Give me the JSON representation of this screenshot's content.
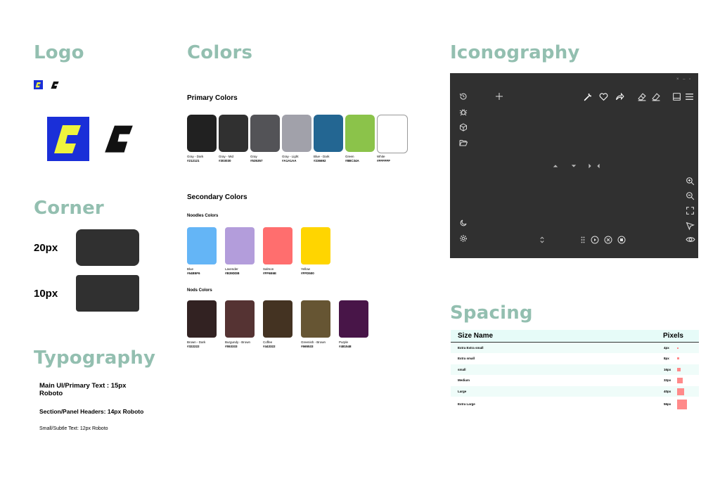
{
  "sections": {
    "logo": "Logo",
    "colors": "Colors",
    "iconography": "Iconography",
    "corner": "Corner",
    "typography": "Typography",
    "spacing": "Spacing"
  },
  "brand": {
    "logo_bg": "#1a2fd8",
    "logo_fg": "#eef33d"
  },
  "colors": {
    "primary_title": "Primary Colors",
    "primary": [
      {
        "name": "Gray - Dark",
        "hex": "#212121"
      },
      {
        "name": "Gray - Mid",
        "hex": "#303030"
      },
      {
        "name": "Gray",
        "hex": "#535357"
      },
      {
        "name": "Gray - Light",
        "hex": "#A1A1AA"
      },
      {
        "name": "Blue - Dark",
        "hex": "#236692"
      },
      {
        "name": "Green",
        "hex": "#8BC34A"
      },
      {
        "name": "White",
        "hex": "#FFFFFF"
      }
    ],
    "secondary_title": "Secondary Colors",
    "noodles_title": "Noodles Colors",
    "noodles": [
      {
        "name": "Blue",
        "hex": "#64B5F6"
      },
      {
        "name": "Lavender",
        "hex": "#B39DDB"
      },
      {
        "name": "Salmon",
        "hex": "#FF6E6E"
      },
      {
        "name": "Yellow",
        "hex": "#FFD500"
      }
    ],
    "nods_title": "Nods Colors",
    "nods": [
      {
        "name": "Brown - Dark",
        "hex": "#322222"
      },
      {
        "name": "Burgundy - Brown",
        "hex": "#553333"
      },
      {
        "name": "Coffee",
        "hex": "#443322"
      },
      {
        "name": "Greenish - Brown",
        "hex": "#665533"
      },
      {
        "name": "Purple",
        "hex": "#481548"
      }
    ]
  },
  "corner": {
    "items": [
      {
        "label": "20px",
        "radius": "20px"
      },
      {
        "label": "10px",
        "radius": "10px"
      }
    ]
  },
  "typography": {
    "main": "Main UI/Primary Text : 15px Roboto",
    "section": "Section/Panel Headers: 14px Roboto",
    "small": "Small/Subtle Text: 12px Roboto"
  },
  "spacing": {
    "col_name": "Size Name",
    "col_pixels": "Pixels",
    "rows": [
      {
        "name": "Extra Extra small",
        "pixels": "4px"
      },
      {
        "name": "Extra small",
        "pixels": "8px"
      },
      {
        "name": "small",
        "pixels": "16px"
      },
      {
        "name": "Medium",
        "pixels": "32px"
      },
      {
        "name": "Large",
        "pixels": "40px"
      },
      {
        "name": "Extra Large",
        "pixels": "56px"
      }
    ]
  },
  "iconography": {
    "window_controls": "× – ▫"
  }
}
